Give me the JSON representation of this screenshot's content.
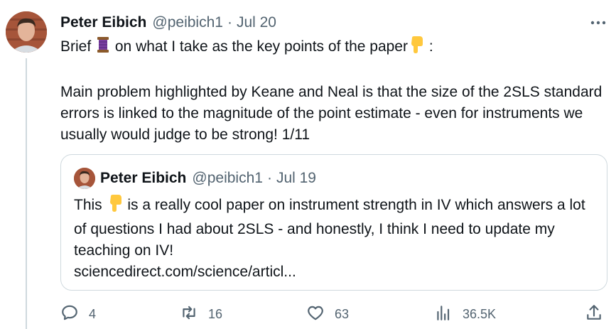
{
  "tweet": {
    "author_name": "Peter Eibich",
    "handle": "@peibich1",
    "separator": "·",
    "date": "Jul 20",
    "text_line1_a": "Brief",
    "text_line1_b": "on what I take as the key points of the paper",
    "text_line1_c": ":",
    "text_para2": "Main problem highlighted by Keane and Neal is that the size of the 2SLS standard errors is linked to the magnitude of the point estimate - even for instruments we usually would judge to be strong! 1/11"
  },
  "quoted_tweet": {
    "author_name": "Peter Eibich",
    "handle": "@peibich1",
    "separator": "·",
    "date": "Jul 19",
    "text_a": "This",
    "text_b": "is a really cool paper on instrument strength in IV which answers a lot of questions I had about 2SLS - and honestly, I think I need to update my teaching on IV!",
    "link": "sciencedirect.com/science/articl..."
  },
  "actions": {
    "reply_count": "4",
    "retweet_count": "16",
    "like_count": "63",
    "views_count": "36.5K"
  },
  "icons": [
    "more-icon",
    "thread-emoji-icon",
    "pointing-down-emoji-icon",
    "reply-icon",
    "retweet-icon",
    "like-icon",
    "views-icon",
    "share-icon"
  ],
  "colors": {
    "text": "#0f1419",
    "muted": "#536471",
    "border": "#cfd9de"
  }
}
